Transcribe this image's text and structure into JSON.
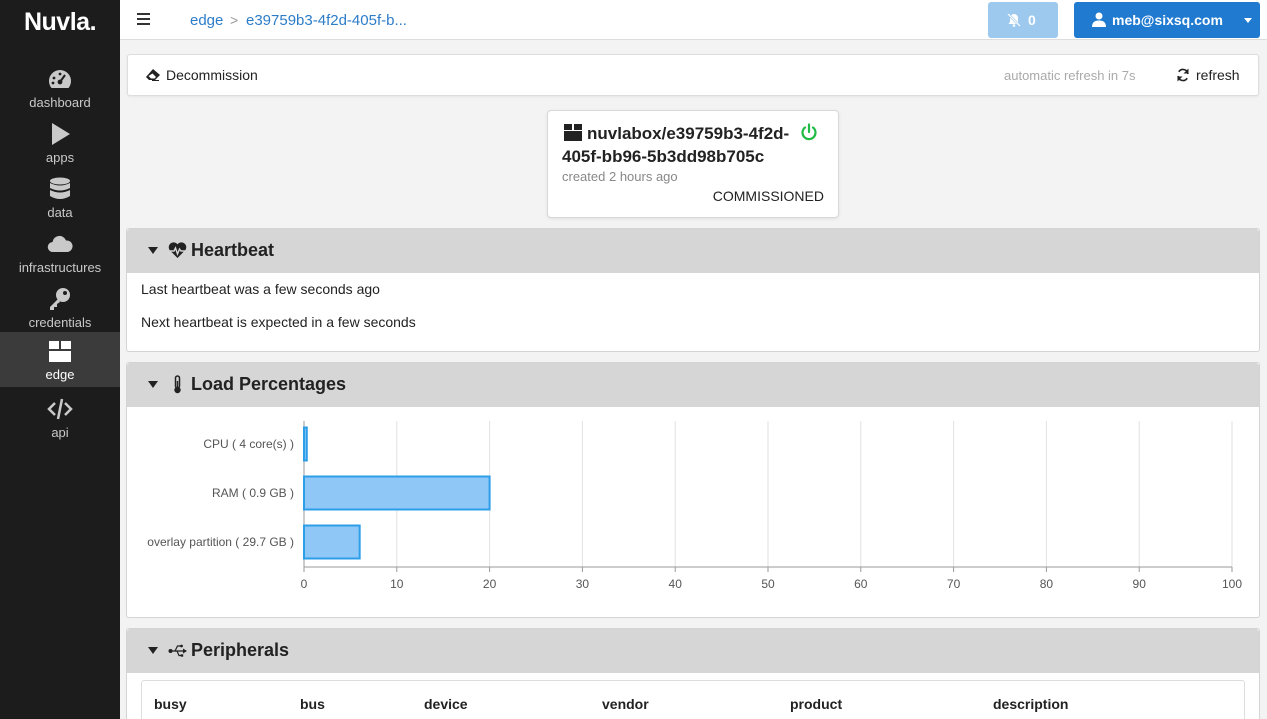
{
  "app": {
    "logo": "Nuvla."
  },
  "sidebar": {
    "items": [
      {
        "label": "dashboard",
        "icon": "dashboard-icon",
        "active": false
      },
      {
        "label": "apps",
        "icon": "play-icon",
        "active": false
      },
      {
        "label": "data",
        "icon": "database-icon",
        "active": false
      },
      {
        "label": "infrastructures",
        "icon": "cloud-icon",
        "active": false
      },
      {
        "label": "credentials",
        "icon": "key-icon",
        "active": false
      },
      {
        "label": "edge",
        "icon": "box-icon",
        "active": true
      },
      {
        "label": "api",
        "icon": "code-icon",
        "active": false
      }
    ]
  },
  "header": {
    "breadcrumb": [
      "edge",
      "e39759b3-4f2d-405f-b..."
    ],
    "breadcrumb_separator": ">",
    "notifications": {
      "count": "0",
      "icon": "bell-slash-icon"
    },
    "user": {
      "label": "meb@sixsq.com",
      "icon": "user-icon"
    }
  },
  "toolbar": {
    "decommission_label": "Decommission",
    "auto_refresh_text": "automatic refresh in 7s",
    "refresh_label": "refresh"
  },
  "nuvlabox": {
    "title": "nuvlabox/e39759b3-4f2d-405f-bb96-5b3dd98b705c",
    "created": "created 2 hours ago",
    "state": "COMMISSIONED",
    "online_color": "#21ba45"
  },
  "heartbeat": {
    "title": "Heartbeat",
    "last": "Last heartbeat was a few seconds ago",
    "next": "Next heartbeat is expected in a few seconds"
  },
  "load": {
    "title": "Load Percentages"
  },
  "chart_data": {
    "type": "bar",
    "orientation": "horizontal",
    "categories": [
      "CPU ( 4 core(s) )",
      "RAM ( 0.9 GB )",
      "overlay partition ( 29.7 GB )"
    ],
    "values": [
      0.3,
      20,
      6
    ],
    "xlim": [
      0,
      100
    ],
    "xticks": [
      0,
      10,
      20,
      30,
      40,
      50,
      60,
      70,
      80,
      90,
      100
    ],
    "grid": true,
    "bar_color": "#8fc7f7",
    "bar_border_color": "#2d9ee8"
  },
  "peripherals": {
    "title": "Peripherals",
    "columns": [
      "busy",
      "bus",
      "device",
      "vendor",
      "product",
      "description"
    ]
  }
}
